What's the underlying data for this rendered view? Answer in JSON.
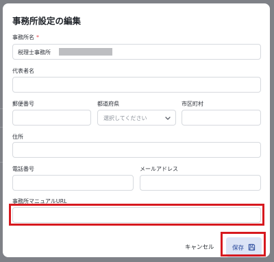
{
  "modal": {
    "title": "事務所設定の編集"
  },
  "form": {
    "office_name": {
      "label": "事務所名",
      "required_mark": "*",
      "value": "税理士事務所"
    },
    "representative": {
      "label": "代表者名",
      "value": ""
    },
    "postal_code": {
      "label": "郵便番号",
      "value": ""
    },
    "prefecture": {
      "label": "都道府県",
      "placeholder": "選択してください"
    },
    "city": {
      "label": "市区町村",
      "value": ""
    },
    "address": {
      "label": "住所",
      "value": ""
    },
    "phone": {
      "label": "電話番号",
      "value": ""
    },
    "email": {
      "label": "メールアドレス",
      "value": ""
    },
    "manual_url": {
      "label": "事務所マニュアルURL",
      "value": ""
    }
  },
  "actions": {
    "cancel_label": "キャンセル",
    "save_label": "保存"
  },
  "colors": {
    "accent": "#2a4a9c",
    "save_bg": "#dce4f6",
    "highlight": "#d7191f",
    "required": "#e5484d"
  },
  "icons": {
    "select": "chevron-down-icon",
    "save": "floppy-disk-icon"
  }
}
